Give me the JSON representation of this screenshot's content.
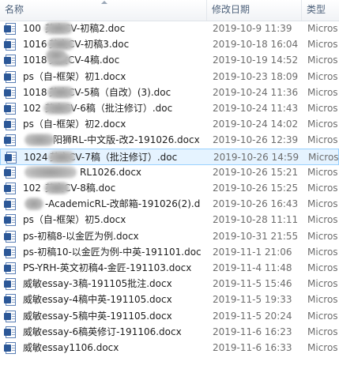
{
  "columns": {
    "name": "名称",
    "date": "修改日期",
    "type": "类型"
  },
  "files": [
    {
      "name": "100",
      "name_tail": "英文CV-初稿2.doc",
      "date": "2019-10-9 11:39",
      "type": "Micros",
      "redacted": true
    },
    {
      "name": "1016",
      "name_tail": "英文CV-初稿3.doc",
      "date": "2019-10-18 16:04",
      "type": "Micros",
      "redacted": true
    },
    {
      "name": "1018",
      "name_tail": "英文CV-4稿.doc",
      "date": "2019-10-19 14:52",
      "type": "Micros",
      "redacted": true
    },
    {
      "name": "ps（自-框架）初1.docx",
      "date": "2019-10-23 18:09",
      "type": "Micros"
    },
    {
      "name": "1018",
      "name_tail": "英文CV-5稿（自改）(3).doc",
      "date": "2019-10-24 11:36",
      "type": "Micros",
      "redacted": true
    },
    {
      "name": "102",
      "name_tail": "英文CV-6稿（批注修订）.doc",
      "date": "2019-10-24 11:43",
      "type": "Micros",
      "redacted": true
    },
    {
      "name": "ps（自-框架）初2.docx",
      "date": "2019-10-24 14:02",
      "type": "Micros"
    },
    {
      "name": "",
      "name_tail": "阳狮RL-中文版-改2-191026.docx",
      "date": "2019-10-26 12:39",
      "type": "Micros",
      "redacted": true
    },
    {
      "name": "1024",
      "name_tail": "英文CV-7稿（批注修订）.doc",
      "date": "2019-10-26 14:59",
      "type": "Micros",
      "redacted": true,
      "selected": true
    },
    {
      "name": "",
      "name_tail": "RL1026.docx",
      "date": "2019-10-26 15:21",
      "type": "Micros",
      "redacted": true
    },
    {
      "name": "102",
      "name_tail": "英文CV-8稿.doc",
      "date": "2019-10-26 15:25",
      "type": "Micros",
      "redacted": true
    },
    {
      "name": "",
      "name_tail": "-AcademicRL-改邮箱-191026(2).d",
      "date": "2019-10-26 16:43",
      "type": "Micros",
      "redacted": true
    },
    {
      "name": "ps（自-框架）初5.docx",
      "date": "2019-10-28 11:11",
      "type": "Micros"
    },
    {
      "name": "ps-初稿8-以金匠为例.docx",
      "date": "2019-10-31 21:55",
      "type": "Micros"
    },
    {
      "name": "ps-初稿10-以金匠为例-中英-191101.doc",
      "date": "2019-11-1 21:06",
      "type": "Micros"
    },
    {
      "name": "PS-YRH-英文初稿4-金匠-191103.docx",
      "date": "2019-11-4 11:48",
      "type": "Micros"
    },
    {
      "name": "威敏essay-3稿-191105批注.docx",
      "date": "2019-11-5 15:46",
      "type": "Micros"
    },
    {
      "name": "威敏essay-4稿中英-191105.docx",
      "date": "2019-11-5 19:33",
      "type": "Micros"
    },
    {
      "name": "威敏essay-5稿中英-191105.docx",
      "date": "2019-11-5 20:24",
      "type": "Micros"
    },
    {
      "name": "威敏essay-6稿英修订-191106.docx",
      "date": "2019-11-6 16:23",
      "type": "Micros"
    },
    {
      "name": "威敏essay1106.docx",
      "date": "2019-11-6 16:33",
      "type": "Micros"
    }
  ]
}
